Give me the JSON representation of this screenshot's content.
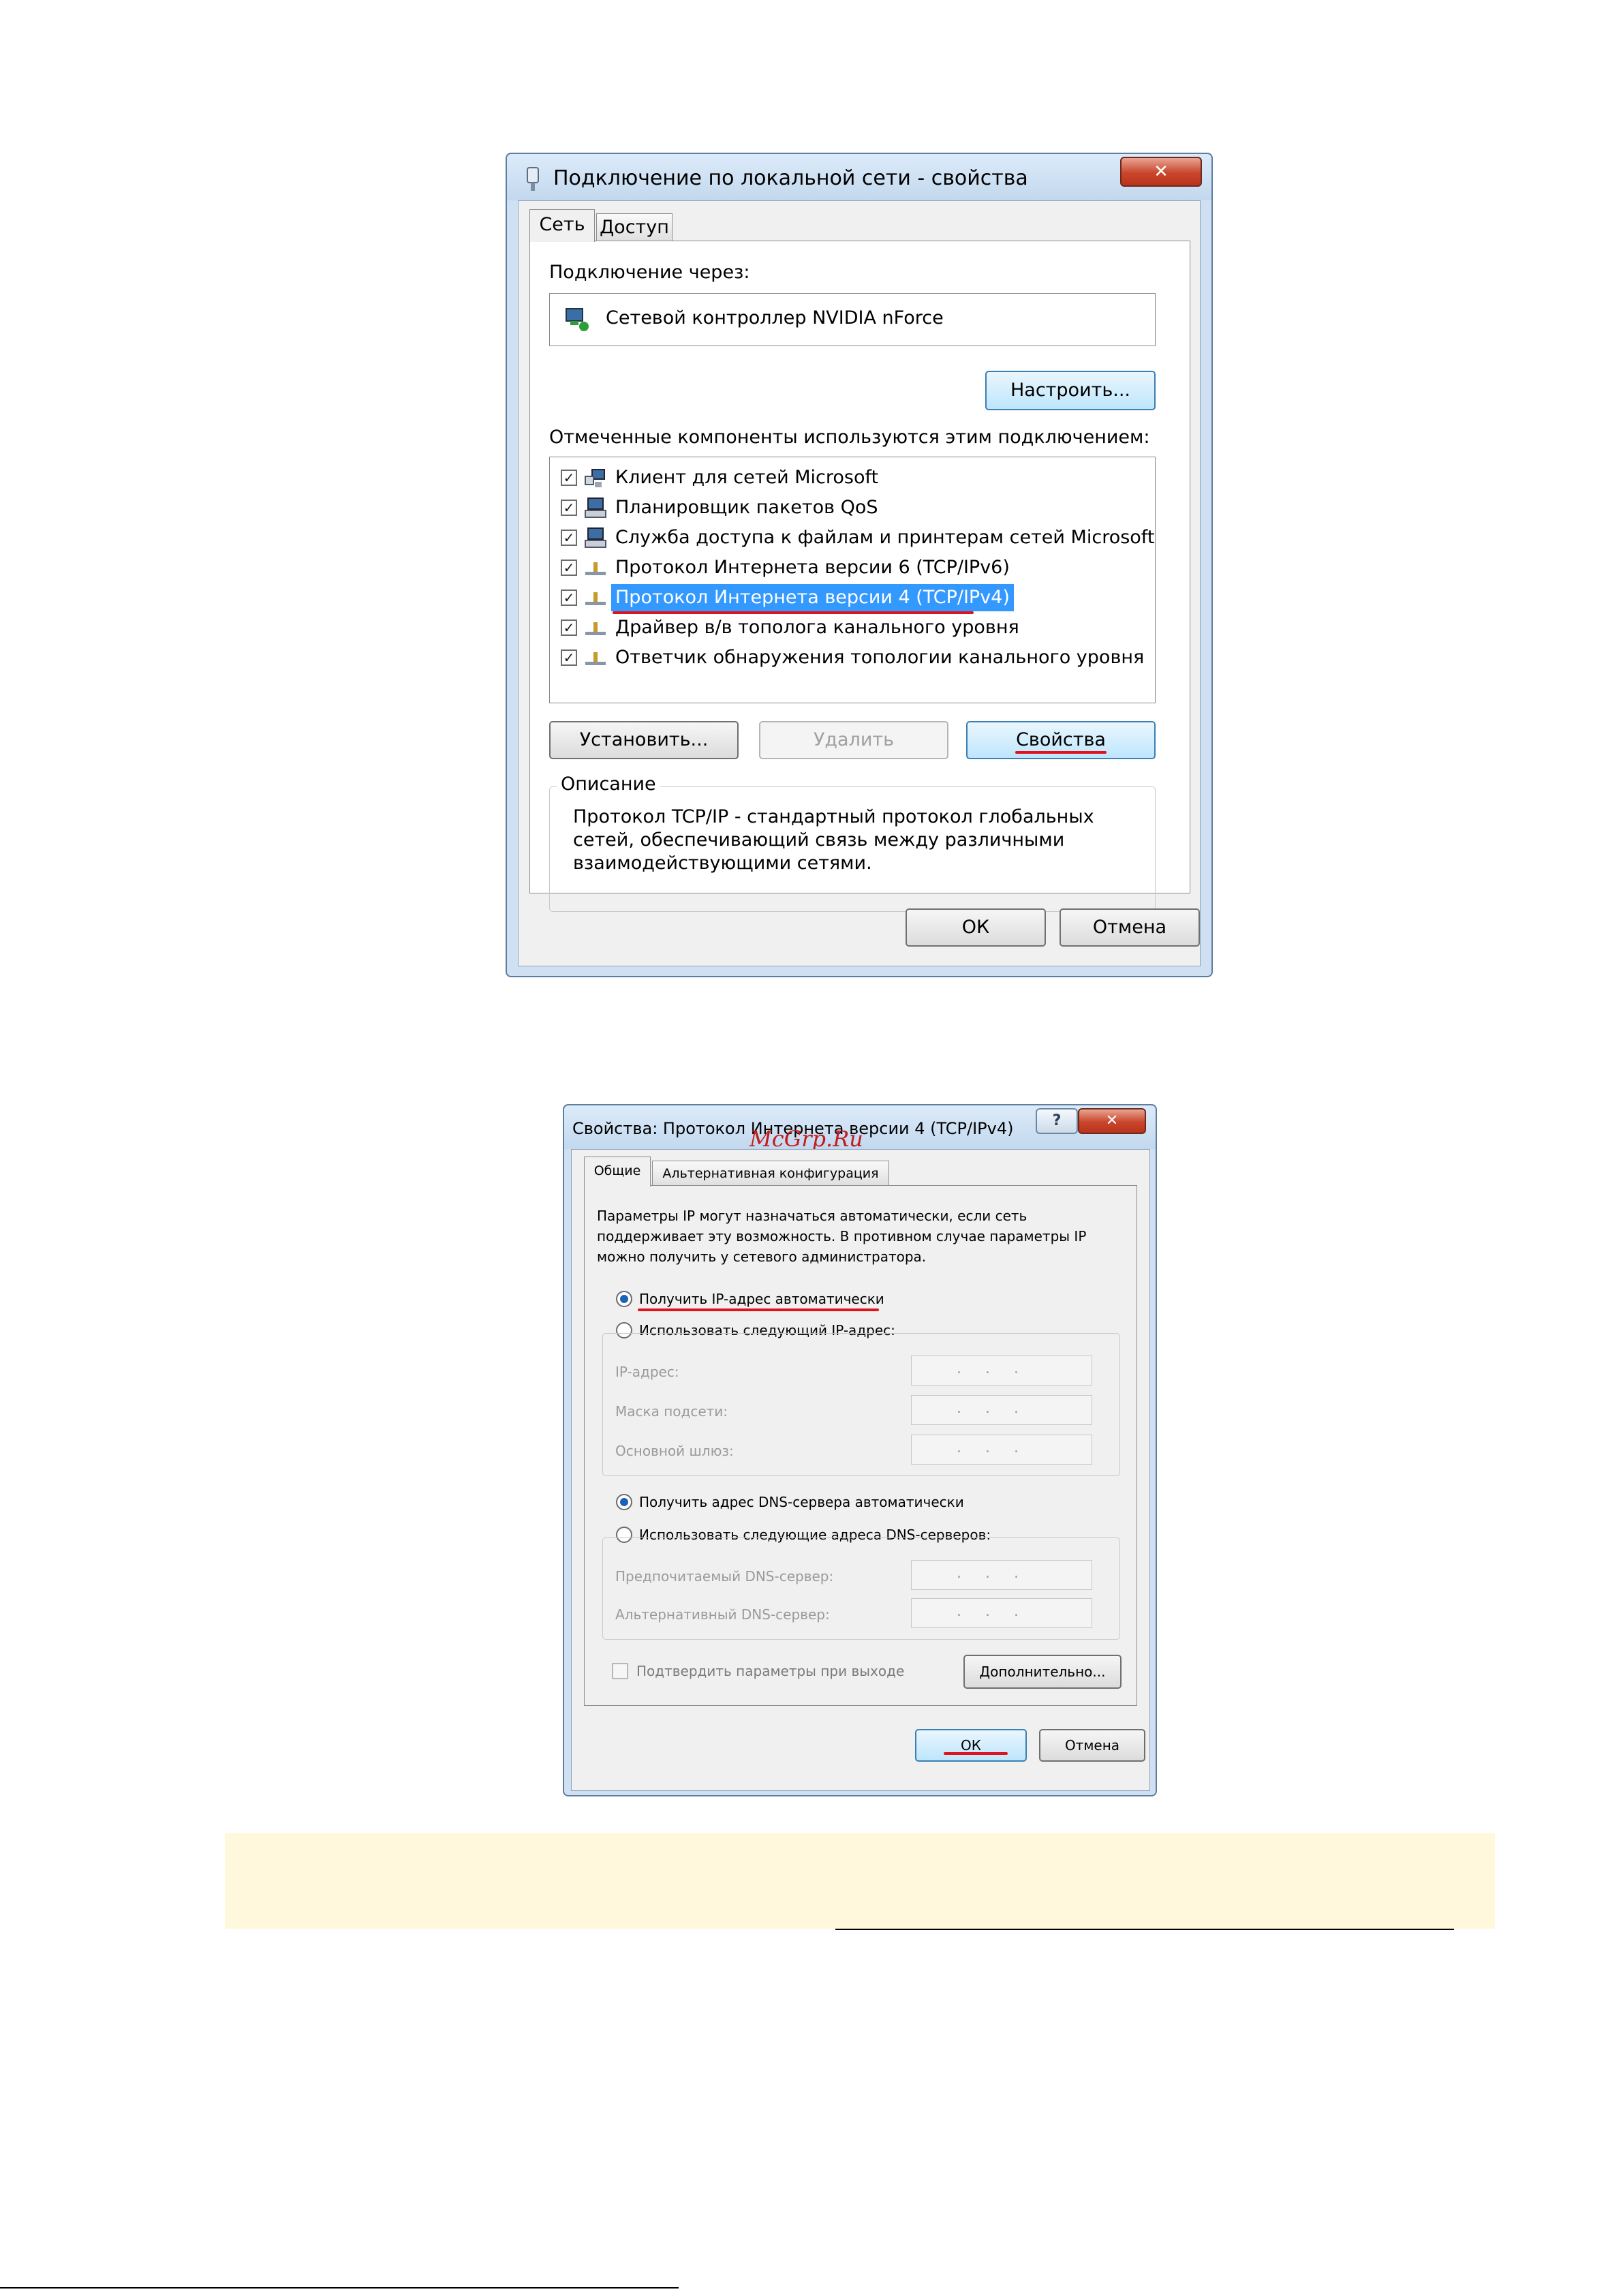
{
  "dialog1": {
    "title": "Подключение по локальной сети - свойства",
    "close_glyph": "✕",
    "tabs": [
      "Сеть",
      "Доступ"
    ],
    "connect_via_label": "Подключение через:",
    "adapter_name": "Сетевой контроллер NVIDIA nForce",
    "configure_button": "Настроить...",
    "components_label": "Отмеченные компоненты используются этим подключением:",
    "components": [
      {
        "label": "Клиент для сетей Microsoft",
        "icon": "network-client-icon",
        "checked": true
      },
      {
        "label": "Планировщик пакетов QoS",
        "icon": "network-service-icon",
        "checked": true
      },
      {
        "label": "Служба доступа к файлам и принтерам сетей Microsoft",
        "icon": "network-service-icon",
        "checked": true
      },
      {
        "label": "Протокол Интернета версии 6 (TCP/IPv6)",
        "icon": "network-protocol-icon",
        "checked": true
      },
      {
        "label": "Протокол Интернета версии 4 (TCP/IPv4)",
        "icon": "network-protocol-icon",
        "checked": true,
        "selected": true
      },
      {
        "label": "Драйвер в/в тополога канального уровня",
        "icon": "network-protocol-icon",
        "checked": true
      },
      {
        "label": "Ответчик обнаружения топологии канального уровня",
        "icon": "network-protocol-icon",
        "checked": true
      }
    ],
    "install_button": "Установить...",
    "remove_button": "Удалить",
    "properties_button": "Свойства",
    "description_legend": "Описание",
    "description_lines": [
      "Протокол TCP/IP - стандартный протокол глобальных",
      "сетей, обеспечивающий связь между различными",
      "взаимодействующими сетями."
    ],
    "ok_button": "ОК",
    "cancel_button": "Отмена"
  },
  "dialog2": {
    "title": "Свойства: Протокол Интернета версии 4 (TCP/IPv4)",
    "help_glyph": "?",
    "close_glyph": "✕",
    "watermark": "McGrp.Ru",
    "tabs": [
      "Общие",
      "Альтернативная конфигурация"
    ],
    "intro_lines": [
      "Параметры IP могут назначаться автоматически, если сеть",
      "поддерживает эту возможность. В противном случае параметры IP",
      "можно получить у сетевого администратора."
    ],
    "ip_auto_label": "Получить IP-адрес автоматически",
    "ip_manual_label": "Использовать следующий IP-адрес:",
    "ip_fields": [
      "IP-адрес:",
      "Маска подсети:",
      "Основной шлюз:"
    ],
    "dns_auto_label": "Получить адрес DNS-сервера автоматически",
    "dns_manual_label": "Использовать следующие адреса DNS-серверов:",
    "dns_fields": [
      "Предпочитаемый DNS-сервер:",
      "Альтернативный DNS-сервер:"
    ],
    "ip_dots": ". . .",
    "validate_label": "Подтвердить параметры при выходе",
    "advanced_button": "Дополнительно...",
    "ok_button": "ОК",
    "cancel_button": "Отмена"
  },
  "colors": {
    "selection": "#3399ff",
    "annotation_underline": "#e0121c",
    "note_background": "#fff8dd"
  }
}
